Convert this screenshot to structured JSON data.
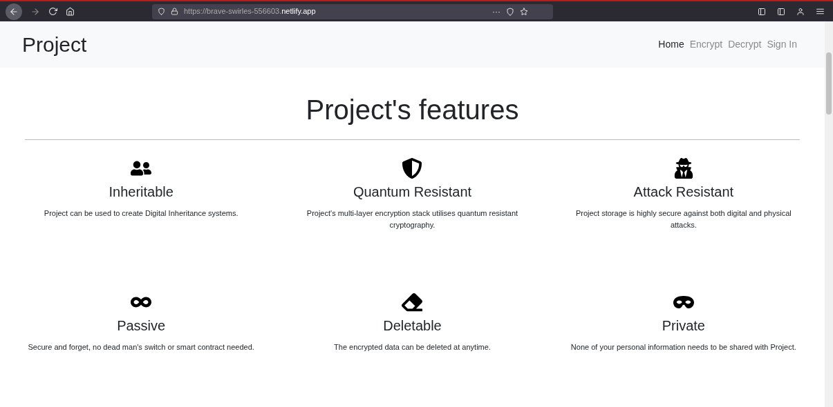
{
  "browser": {
    "url_prefix": "https://brave-swirles-556603.",
    "url_domain": "netlify.app",
    "menu_dots": "···"
  },
  "navbar": {
    "brand": "Project",
    "links": [
      {
        "label": "Home",
        "selected": true
      },
      {
        "label": "Encrypt",
        "selected": false
      },
      {
        "label": "Decrypt",
        "selected": false
      },
      {
        "label": "Sign In",
        "selected": false
      }
    ]
  },
  "heading": "Project's features",
  "features": [
    {
      "kind": "people",
      "title": "Inheritable",
      "text": "Project can be used to create Digital Inheritance systems."
    },
    {
      "kind": "shield",
      "title": "Quantum Resistant",
      "text": "Project's multi-layer encryption stack utilises quantum resistant cryptography."
    },
    {
      "kind": "spy",
      "title": "Attack Resistant",
      "text": "Project storage is highly secure against both digital and physical attacks."
    },
    {
      "kind": "infinity",
      "title": "Passive",
      "text": "Secure and forget, no dead man's switch or smart contract needed."
    },
    {
      "kind": "eraser",
      "title": "Deletable",
      "text": "The encrypted data can be deleted at anytime."
    },
    {
      "kind": "mask",
      "title": "Private",
      "text": "None of your personal information needs to be shared with Project."
    }
  ]
}
